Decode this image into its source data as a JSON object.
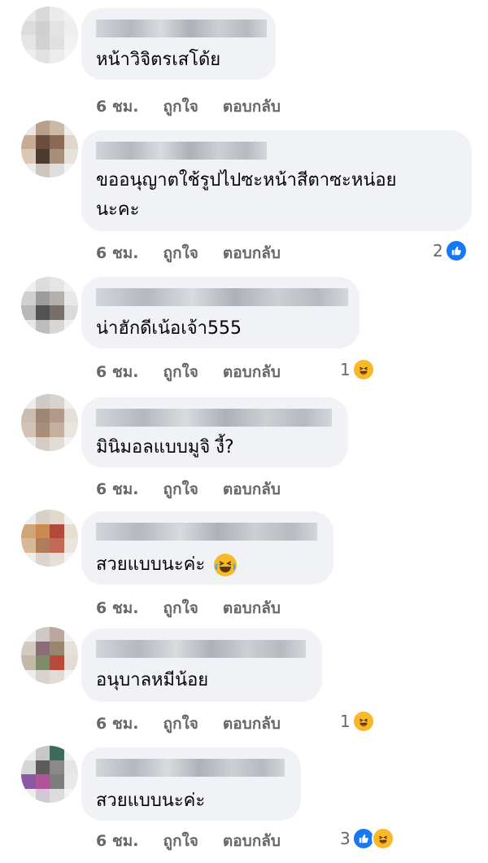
{
  "actions": {
    "time": "6 ชม.",
    "like": "ถูกใจ",
    "reply": "ตอบกลับ"
  },
  "comments": [
    {
      "text_lines": [
        "หน้าวิจิตรเสโด้ย"
      ],
      "reaction_count": "",
      "reactions": []
    },
    {
      "text_lines": [
        "ขออนุญาตใช้รูปไปซะหน้าสีตาซะหน่อย",
        "นะคะ"
      ],
      "reaction_count": "2",
      "reactions": [
        "like"
      ]
    },
    {
      "text_lines": [
        "น่าฮักดีเน้อเจ้า555"
      ],
      "reaction_count": "1",
      "reactions": [
        "haha"
      ]
    },
    {
      "text_lines": [
        "มินิมอลแบบมูจิ งี้?"
      ],
      "reaction_count": "",
      "reactions": []
    },
    {
      "text_lines": [
        "สวยแบบนะค่ะ"
      ],
      "reaction_count": "",
      "reactions": [],
      "inline_emoji": "crying-laughing"
    },
    {
      "text_lines": [
        "อนุบาลหมีน้อย"
      ],
      "reaction_count": "1",
      "reactions": [
        "haha"
      ]
    },
    {
      "text_lines": [
        "สวยแบบนะค่ะ"
      ],
      "reaction_count": "3",
      "reactions": [
        "like",
        "haha"
      ]
    }
  ],
  "colors": {
    "bubble": "#f0f2f5",
    "meta": "#65676b",
    "like": "#1877f2",
    "haha": "#f7b928"
  }
}
